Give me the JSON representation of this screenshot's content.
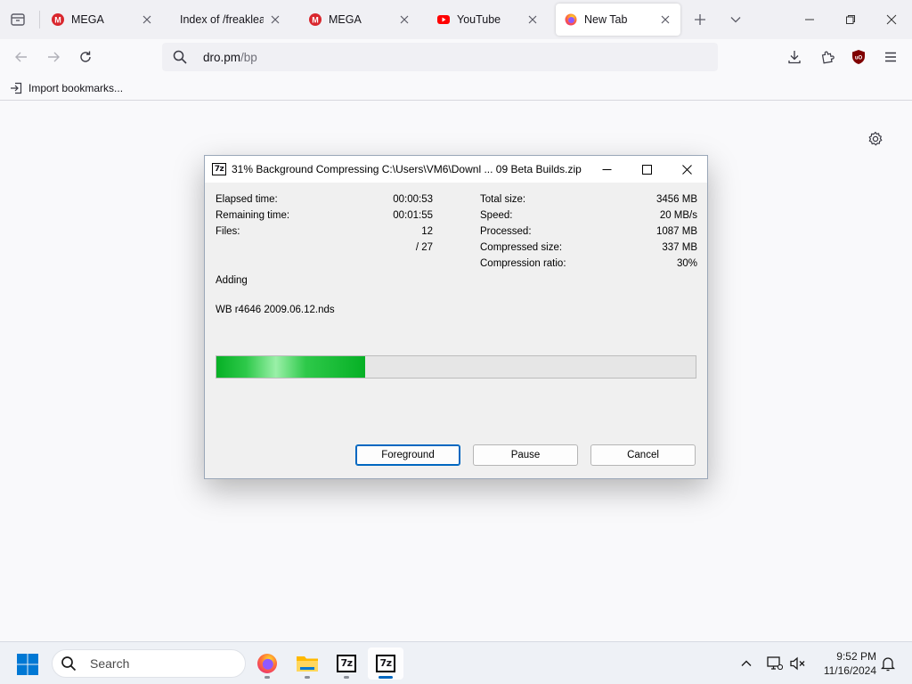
{
  "browser": {
    "tabs": [
      {
        "title": "MEGA",
        "favicon": "mega-icon",
        "active": false
      },
      {
        "title": "Index of /freakleak/A",
        "favicon": "",
        "active": false
      },
      {
        "title": "MEGA",
        "favicon": "mega-icon",
        "active": false
      },
      {
        "title": "YouTube",
        "favicon": "youtube-icon",
        "active": false
      },
      {
        "title": "New Tab",
        "favicon": "firefox-icon",
        "active": true
      }
    ],
    "url_host": "dro.pm",
    "url_path": "/bp",
    "bookmarks_bar": {
      "import_label": "Import bookmarks..."
    }
  },
  "dialog": {
    "title": "31% Background Compressing C:\\Users\\VM6\\Downl ... 09 Beta Builds.zip",
    "progress_fraction": 0.31,
    "stats_left": [
      {
        "label": "Elapsed time:",
        "value": "00:00:53"
      },
      {
        "label": "Remaining time:",
        "value": "00:01:55"
      },
      {
        "label": "Files:",
        "value": "12"
      },
      {
        "label": "",
        "value": "/ 27"
      }
    ],
    "stats_right": [
      {
        "label": "Total size:",
        "value": "3456 MB"
      },
      {
        "label": "Speed:",
        "value": "20 MB/s"
      },
      {
        "label": "Processed:",
        "value": "1087 MB"
      },
      {
        "label": "Compressed size:",
        "value": "337 MB"
      },
      {
        "label": "Compression ratio:",
        "value": "30%"
      }
    ],
    "status_text": "Adding",
    "current_file": "WB r4646 2009.06.12.nds",
    "buttons": {
      "foreground": "Foreground",
      "pause": "Pause",
      "cancel": "Cancel"
    }
  },
  "taskbar": {
    "search_placeholder": "Search",
    "time": "9:52 PM",
    "date": "11/16/2024"
  },
  "colors": {
    "accent": "#0067c0",
    "progress": "#06b025",
    "mega": "#d9272e",
    "youtube": "#ff0000"
  }
}
